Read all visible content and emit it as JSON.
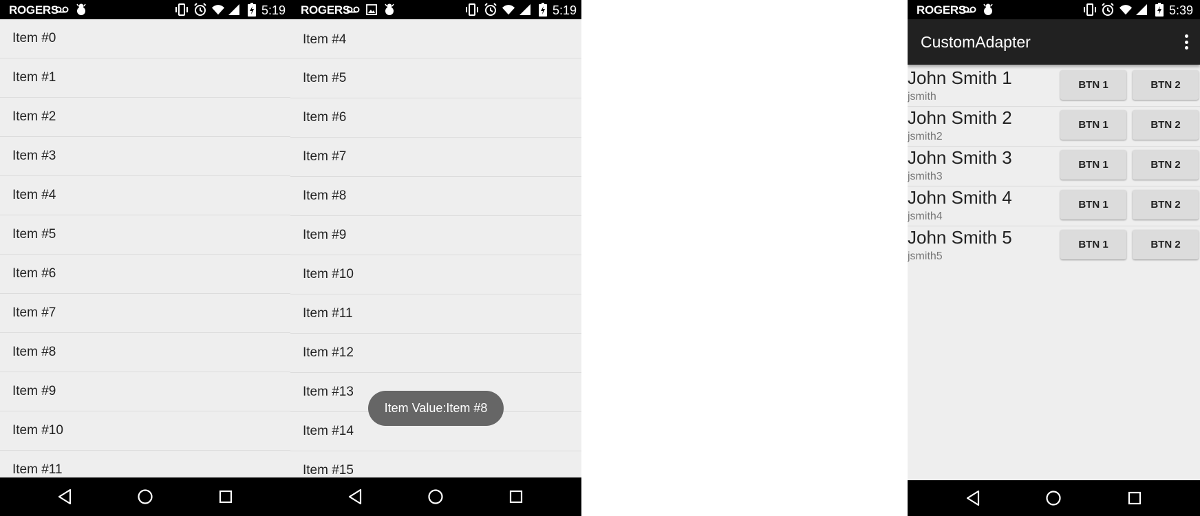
{
  "colors": {
    "status_bar": "#000000",
    "nav_bar": "#000000",
    "list_bg": "#eeeeee",
    "app_bar": "#212121",
    "toast_bg": "#666666"
  },
  "screen1": {
    "status": {
      "carrier": "ROGERS",
      "time": "5:19",
      "icons": [
        "voicemail-icon",
        "android-debug-icon",
        "vibrate-icon",
        "alarm-icon",
        "wifi-icon",
        "signal-icon",
        "battery-charging-icon"
      ]
    },
    "items": [
      "Item #0",
      "Item #1",
      "Item #2",
      "Item #3",
      "Item #4",
      "Item #5",
      "Item #6",
      "Item #7",
      "Item #8",
      "Item #9",
      "Item #10",
      "Item #11"
    ]
  },
  "screen2": {
    "status": {
      "carrier": "ROGERS",
      "time": "5:19",
      "icons": [
        "voicemail-icon",
        "image-icon",
        "android-debug-icon",
        "vibrate-icon",
        "alarm-icon",
        "wifi-icon",
        "signal-icon",
        "battery-charging-icon"
      ]
    },
    "items": [
      "Item #4",
      "Item #5",
      "Item #6",
      "Item #7",
      "Item #8",
      "Item #9",
      "Item #10",
      "Item #11",
      "Item #12",
      "Item #13",
      "Item #14",
      "Item #15"
    ],
    "toast": "Item Value:Item #8"
  },
  "screen3": {
    "status": {
      "carrier": "ROGERS",
      "time": "5:39",
      "icons": [
        "voicemail-icon",
        "android-debug-icon",
        "vibrate-icon",
        "alarm-icon",
        "wifi-icon",
        "signal-icon",
        "battery-charging-icon"
      ]
    },
    "app_title": "CustomAdapter",
    "rows": [
      {
        "name": "John Smith 1",
        "username": "jsmith",
        "btn1": "BTN 1",
        "btn2": "BTN 2"
      },
      {
        "name": "John Smith 2",
        "username": "jsmith2",
        "btn1": "BTN 1",
        "btn2": "BTN 2"
      },
      {
        "name": "John Smith 3",
        "username": "jsmith3",
        "btn1": "BTN 1",
        "btn2": "BTN 2"
      },
      {
        "name": "John Smith 4",
        "username": "jsmith4",
        "btn1": "BTN 1",
        "btn2": "BTN 2"
      },
      {
        "name": "John Smith 5",
        "username": "jsmith5",
        "btn1": "BTN 1",
        "btn2": "BTN 2"
      }
    ]
  },
  "nav_buttons": [
    "back-icon",
    "home-icon",
    "recents-icon"
  ]
}
